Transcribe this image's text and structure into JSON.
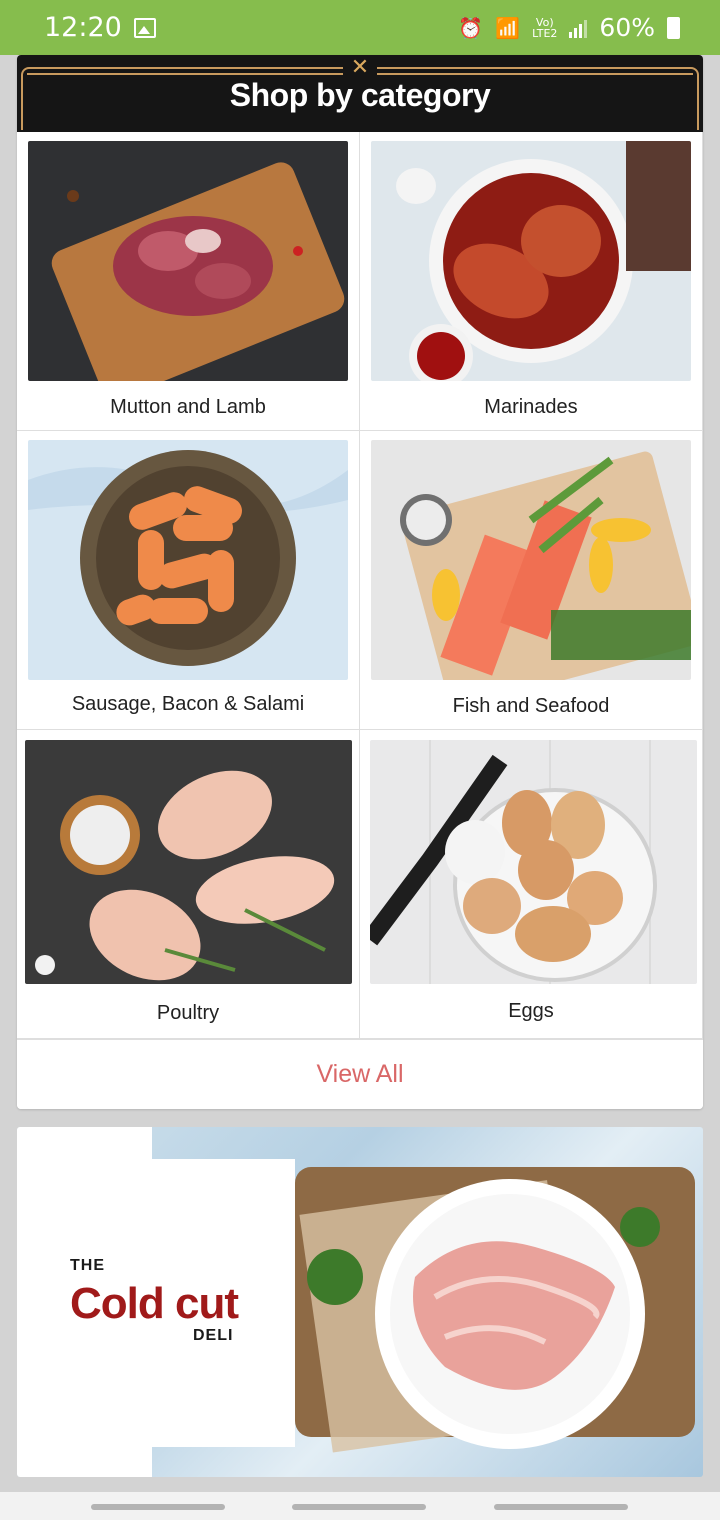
{
  "status_bar": {
    "time": "12:20",
    "network_label": "Vo)\nLTE2",
    "battery_percent": "60%",
    "battery_glyph": "7"
  },
  "category_section": {
    "title": "Shop by category",
    "items": [
      {
        "label": "Mutton and Lamb",
        "image": "mutton-lamb-photo"
      },
      {
        "label": "Marinades",
        "image": "marinades-photo"
      },
      {
        "label": "Sausage, Bacon & Salami",
        "image": "sausage-photo"
      },
      {
        "label": "Fish and Seafood",
        "image": "salmon-photo"
      },
      {
        "label": "Poultry",
        "image": "chicken-photo"
      },
      {
        "label": "Eggs",
        "image": "eggs-photo"
      }
    ],
    "view_all_label": "View All"
  },
  "banner": {
    "logo_the": "THE",
    "logo_main": "Cold cut",
    "logo_deli": "DELI"
  },
  "colors": {
    "status_bar": "#86bd4d",
    "view_all_text": "#d96767",
    "logo_red": "#a01a1a",
    "header_frame": "#c89a5e"
  }
}
